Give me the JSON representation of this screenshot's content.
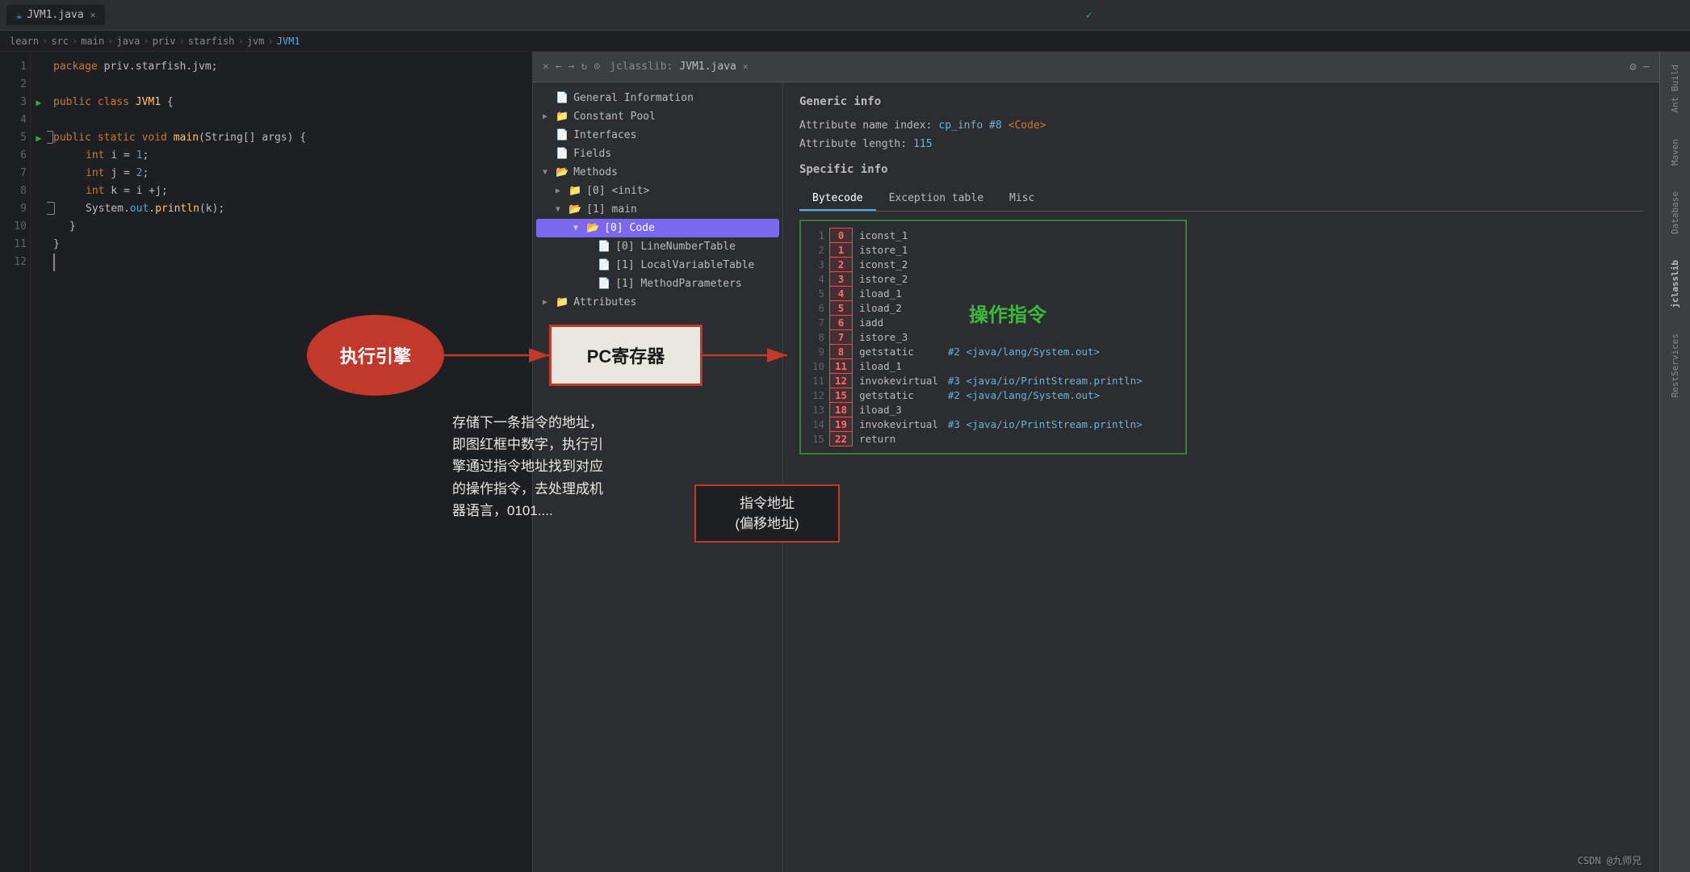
{
  "tabs": {
    "editor_tab": "JVM1.java",
    "jclasslib_tab": "jclasslib:",
    "jclasslib_file": "JVM1.java"
  },
  "breadcrumb": {
    "items": [
      "learn",
      "src",
      "main",
      "java",
      "priv",
      "starfish",
      "jvm",
      "JVM1"
    ]
  },
  "editor": {
    "lines": [
      {
        "num": "1",
        "content": "package priv.starfish.jvm;"
      },
      {
        "num": "2",
        "content": ""
      },
      {
        "num": "3",
        "content": "public class JVM1 {"
      },
      {
        "num": "4",
        "content": ""
      },
      {
        "num": "5",
        "content": "    public static void main(String[] args) {"
      },
      {
        "num": "6",
        "content": "        int i = 1;"
      },
      {
        "num": "7",
        "content": "        int j = 2;"
      },
      {
        "num": "8",
        "content": "        int k = i +j;"
      },
      {
        "num": "9",
        "content": "        System.out.println(k);"
      },
      {
        "num": "10",
        "content": "    }"
      },
      {
        "num": "11",
        "content": "}"
      },
      {
        "num": "12",
        "content": ""
      }
    ]
  },
  "tree": {
    "items": [
      {
        "id": "general-info",
        "label": "General Information",
        "indent": 0,
        "type": "file",
        "expandable": false
      },
      {
        "id": "constant-pool",
        "label": "Constant Pool",
        "indent": 0,
        "type": "folder",
        "expandable": true,
        "expanded": false
      },
      {
        "id": "interfaces",
        "label": "Interfaces",
        "indent": 0,
        "type": "file",
        "expandable": false
      },
      {
        "id": "fields",
        "label": "Fields",
        "indent": 0,
        "type": "file",
        "expandable": false
      },
      {
        "id": "methods",
        "label": "Methods",
        "indent": 0,
        "type": "folder",
        "expandable": true,
        "expanded": true
      },
      {
        "id": "init",
        "label": "[0] <init>",
        "indent": 1,
        "type": "folder",
        "expandable": true,
        "expanded": false
      },
      {
        "id": "main",
        "label": "[1] main",
        "indent": 1,
        "type": "folder",
        "expandable": true,
        "expanded": true
      },
      {
        "id": "code",
        "label": "[0] Code",
        "indent": 2,
        "type": "folder",
        "expandable": true,
        "expanded": true,
        "selected": true
      },
      {
        "id": "linenumber",
        "label": "[0] LineNumberTable",
        "indent": 3,
        "type": "file",
        "expandable": false
      },
      {
        "id": "localvariable",
        "label": "[1] LocalVariableTable",
        "indent": 3,
        "type": "file",
        "expandable": false
      },
      {
        "id": "methodparams",
        "label": "[1] MethodParameters",
        "indent": 3,
        "type": "file",
        "expandable": false
      },
      {
        "id": "attributes",
        "label": "Attributes",
        "indent": 0,
        "type": "folder",
        "expandable": true,
        "expanded": false
      }
    ]
  },
  "info_panel": {
    "generic_info_title": "Generic info",
    "attr_name_label": "Attribute name index:",
    "attr_name_value": "cp_info #8",
    "attr_name_suffix": "<Code>",
    "attr_length_label": "Attribute length:",
    "attr_length_value": "115",
    "specific_info_title": "Specific info"
  },
  "bytecode_tabs": [
    "Bytecode",
    "Exception table",
    "Misc"
  ],
  "bytecode_active": "Bytecode",
  "bytecode": [
    {
      "line": "1",
      "offset": "0",
      "instruction": "iconst_1",
      "ref": ""
    },
    {
      "line": "2",
      "offset": "1",
      "instruction": "istore_1",
      "ref": ""
    },
    {
      "line": "3",
      "offset": "2",
      "instruction": "iconst_2",
      "ref": ""
    },
    {
      "line": "4",
      "offset": "3",
      "instruction": "istore_2",
      "ref": ""
    },
    {
      "line": "5",
      "offset": "4",
      "instruction": "iload_1",
      "ref": ""
    },
    {
      "line": "6",
      "offset": "5",
      "instruction": "iload_2",
      "ref": ""
    },
    {
      "line": "7",
      "offset": "6",
      "instruction": "iadd",
      "ref": ""
    },
    {
      "line": "8",
      "offset": "7",
      "instruction": "istore_3",
      "ref": ""
    },
    {
      "line": "9",
      "offset": "8",
      "instruction": "getstatic",
      "ref": "#2 <java/lang/System.out>"
    },
    {
      "line": "10",
      "offset": "11",
      "instruction": "iload_1",
      "ref": ""
    },
    {
      "line": "11",
      "offset": "12",
      "instruction": "invokevirtual",
      "ref": "#3 <java/io/PrintStream.println>"
    },
    {
      "line": "12",
      "offset": "15",
      "instruction": "getstatic",
      "ref": "#2 <java/lang/System.out>"
    },
    {
      "line": "13",
      "offset": "18",
      "instruction": "iload_3",
      "ref": ""
    },
    {
      "line": "14",
      "offset": "19",
      "instruction": "invokevirtual",
      "ref": "#3 <java/io/PrintStream.println>"
    },
    {
      "line": "15",
      "offset": "22",
      "instruction": "return",
      "ref": ""
    }
  ],
  "annotations": {
    "oval_text": "执行引擎",
    "pc_box_text": "PC寄存器",
    "description_text": "存储下一条指令的地址，\n即图红框中数字，执行引\n擎通过指令地址找到对应\n的操作指令，去处理成机\n器语言，0101....",
    "green_label": "操作指令",
    "addr_label": "指令地址\n(偏移地址)"
  },
  "right_sidebar": {
    "labels": [
      "Ant Build",
      "Maven",
      "Database",
      "jclasslib",
      "RestServices"
    ]
  },
  "bottom_bar": {
    "text": "CSDN @九师兄"
  }
}
